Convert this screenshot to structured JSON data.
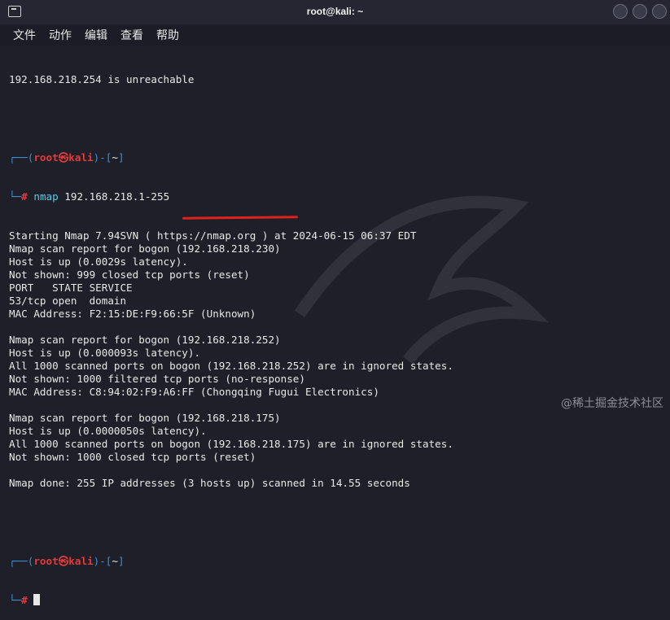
{
  "window": {
    "title": "root@kali: ~"
  },
  "menu": {
    "items": [
      "文件",
      "动作",
      "编辑",
      "查看",
      "帮助"
    ]
  },
  "terminal": {
    "first_line": "192.168.218.254 is unreachable",
    "prompt": {
      "user": "root",
      "at": "㉿",
      "host": "kali",
      "dir": "~",
      "symbol": "#"
    },
    "command": "nmap",
    "command_args": " 192.168.218.1-255",
    "output_lines": [
      "Starting Nmap 7.94SVN ( https://nmap.org ) at 2024-06-15 06:37 EDT",
      "Nmap scan report for bogon (192.168.218.230)",
      "Host is up (0.0029s latency).",
      "Not shown: 999 closed tcp ports (reset)",
      "PORT   STATE SERVICE",
      "53/tcp open  domain",
      "MAC Address: F2:15:DE:F9:66:5F (Unknown)",
      "",
      "Nmap scan report for bogon (192.168.218.252)",
      "Host is up (0.000093s latency).",
      "All 1000 scanned ports on bogon (192.168.218.252) are in ignored states.",
      "Not shown: 1000 filtered tcp ports (no-response)",
      "MAC Address: C8:94:02:F9:A6:FF (Chongqing Fugui Electronics)",
      "",
      "Nmap scan report for bogon (192.168.218.175)",
      "Host is up (0.0000050s latency).",
      "All 1000 scanned ports on bogon (192.168.218.175) are in ignored states.",
      "Not shown: 1000 closed tcp ports (reset)",
      "",
      "Nmap done: 255 IP addresses (3 hosts up) scanned in 14.55 seconds"
    ]
  },
  "watermark": "@稀土掘金技术社区",
  "colors": {
    "background": "#1e1f29",
    "prompt": "#3e8ed0",
    "root": "#e23b3b",
    "command": "#59c9e8",
    "annotation": "#e0221c"
  }
}
